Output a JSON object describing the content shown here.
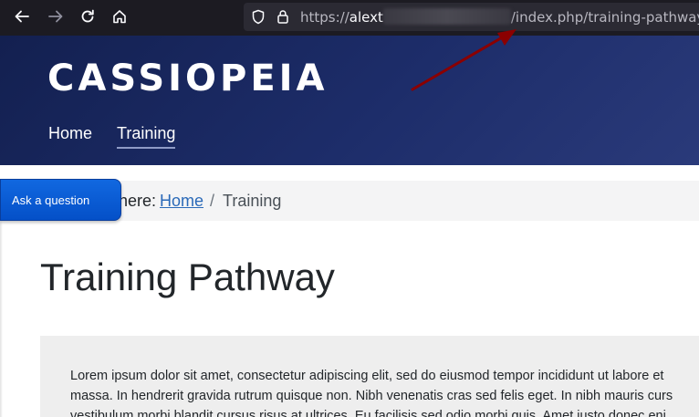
{
  "browser": {
    "url_scheme": "https://",
    "url_host": "alext",
    "url_path": "/index.php/training-pathway",
    "icons": [
      "back-arrow-icon",
      "forward-arrow-icon",
      "reload-icon",
      "home-icon",
      "shield-icon",
      "lock-icon"
    ]
  },
  "site": {
    "brand": "CASSIOPEIA",
    "menu": [
      {
        "label": "Home",
        "active": false
      },
      {
        "label": "Training",
        "active": true
      }
    ],
    "header_gradient": [
      "#132050",
      "#2a3a7a"
    ]
  },
  "annotation": {
    "arrow_color": "#8b0000"
  },
  "ask_button": {
    "label": "Ask a question"
  },
  "breadcrumb": {
    "prefix": "here:",
    "home": "Home",
    "separator": "/",
    "current": "Training"
  },
  "page": {
    "title": "Training Pathway",
    "body_lines": [
      "Lorem ipsum dolor sit amet, consectetur adipiscing elit, sed do eiusmod tempor incididunt ut labore et",
      "massa. In hendrerit gravida rutrum quisque non. Nibh venenatis cras sed felis eget. In nibh mauris curs",
      "vestibulum morbi blandit cursus risus at ultrices. Eu facilisis sed odio morbi quis. Amet justo donec eni"
    ]
  }
}
